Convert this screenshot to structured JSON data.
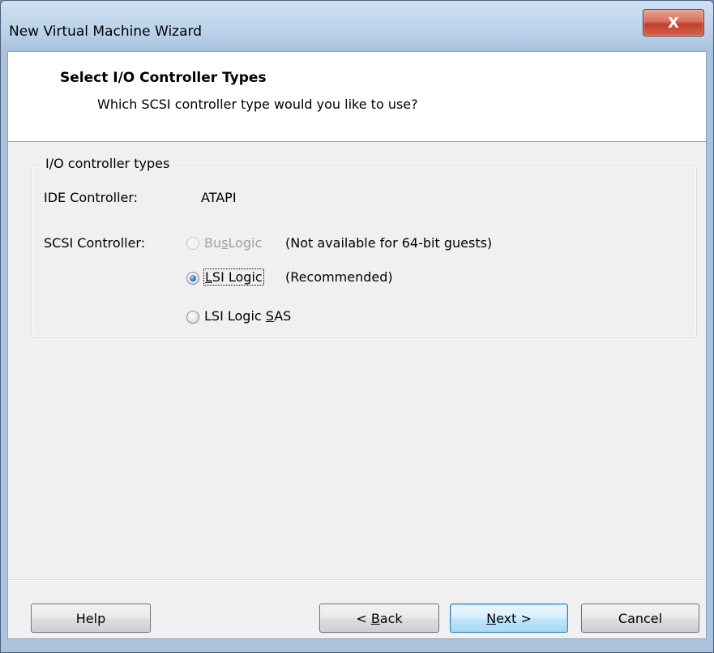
{
  "window": {
    "title": "New Virtual Machine Wizard",
    "close_glyph": "X"
  },
  "header": {
    "title": "Select I/O Controller Types",
    "subtitle": "Which SCSI controller type would you like to use?"
  },
  "group": {
    "legend": "I/O controller types",
    "ide_label": "IDE Controller:",
    "ide_value": "ATAPI",
    "scsi_label": "SCSI Controller:",
    "options": [
      {
        "label_pre": "Bu",
        "label_ul": "s",
        "label_post": "Logic",
        "note": "(Not available for 64-bit guests)",
        "checked": false,
        "disabled": true
      },
      {
        "label_pre": "",
        "label_ul": "L",
        "label_post": "SI Logic",
        "note": "(Recommended)",
        "checked": true,
        "disabled": false
      },
      {
        "label_pre": "LSI Logic ",
        "label_ul": "S",
        "label_post": "AS",
        "note": "",
        "checked": false,
        "disabled": false
      }
    ]
  },
  "buttons": {
    "help": "Help",
    "back_pre": "< ",
    "back_ul": "B",
    "back_post": "ack",
    "next_ul": "N",
    "next_post": "ext >",
    "cancel": "Cancel"
  }
}
